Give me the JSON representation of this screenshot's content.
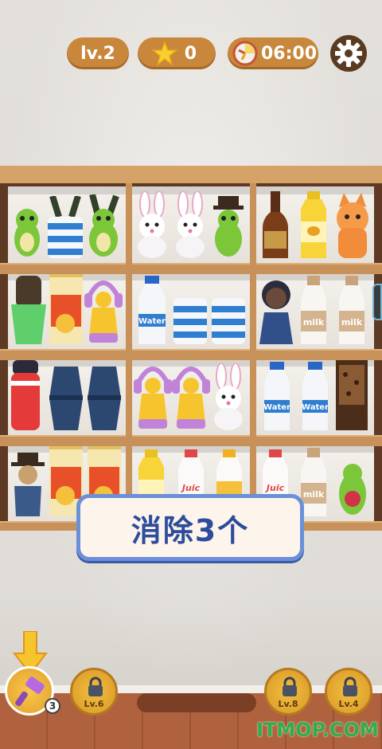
{
  "hud": {
    "level": "lv.2",
    "stars": "0",
    "timer": "06:00"
  },
  "toast": "消除3个",
  "booster": {
    "count": "3",
    "icon": "hammer-icon"
  },
  "locked_slots": [
    {
      "label": "Lv.6"
    },
    {
      "label": "Lv.8"
    },
    {
      "label": "Lv.4"
    }
  ],
  "labels": {
    "water": "Water",
    "milk": "milk",
    "juice": "Juic"
  },
  "watermark": "ITMOP.COM",
  "colors": {
    "hud_pill": "#c8873b",
    "toast_border": "#6b8fd8",
    "toast_text": "#2d4c9c",
    "shelf_wood": "#c8915a",
    "floor": "#b0623e"
  }
}
